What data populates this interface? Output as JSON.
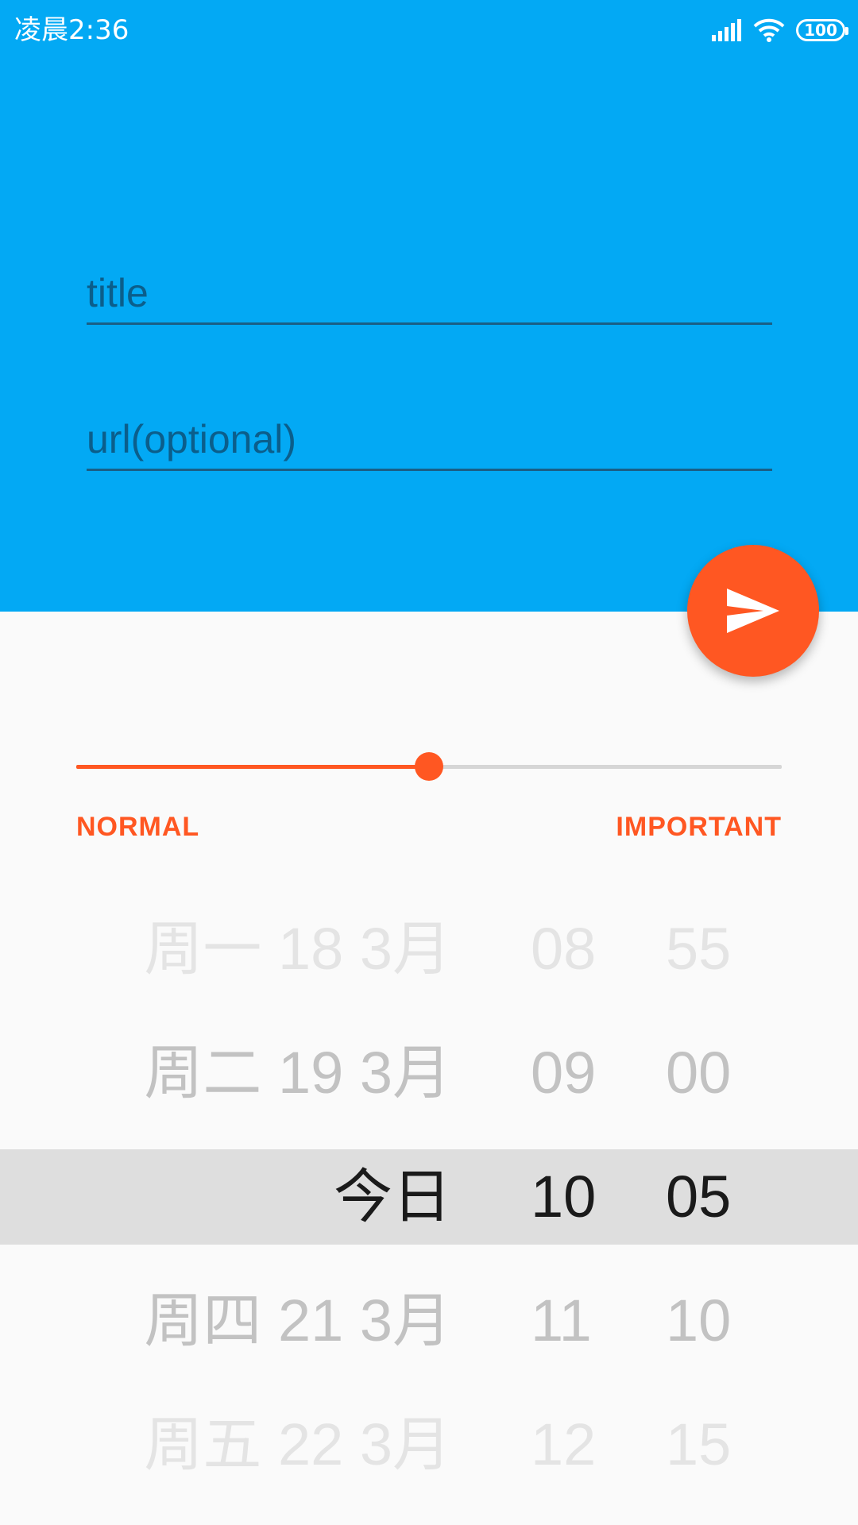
{
  "status_bar": {
    "time": "凌晨2:36",
    "battery": "100",
    "icons": [
      "signal-icon",
      "wifi-icon",
      "battery-icon"
    ]
  },
  "form": {
    "title_placeholder": "title",
    "url_placeholder": "url(optional)"
  },
  "fab": {
    "icon": "send-icon"
  },
  "importance": {
    "min_label": "NORMAL",
    "max_label": "IMPORTANT",
    "value": 0.5
  },
  "picker": {
    "rows": [
      {
        "date": "周一 18 3月",
        "hour": "08",
        "minute": "55"
      },
      {
        "date": "周二 19 3月",
        "hour": "09",
        "minute": "00"
      },
      {
        "date": "今日",
        "hour": "10",
        "minute": "05"
      },
      {
        "date": "周四 21 3月",
        "hour": "11",
        "minute": "10"
      },
      {
        "date": "周五 22 3月",
        "hour": "12",
        "minute": "15"
      }
    ],
    "selected_index": 2
  },
  "colors": {
    "primary": "#03a9f4",
    "accent": "#ff5722",
    "background": "#fafafa"
  }
}
